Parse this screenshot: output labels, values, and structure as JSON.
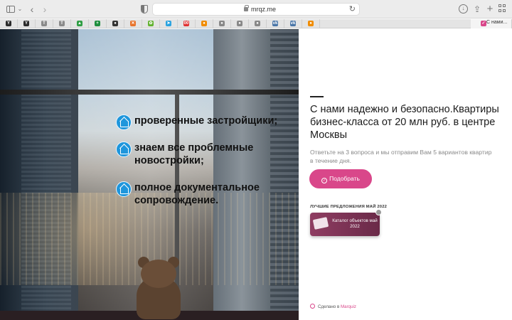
{
  "browser": {
    "url": "mrqz.me",
    "tab_title": "С нами...",
    "favorites": [
      {
        "icon": "bookmark-icon",
        "glyph": "Y",
        "color": "#2b2b2b"
      },
      {
        "icon": "bookmark-icon",
        "glyph": "Y",
        "color": "#2b2b2b"
      },
      {
        "icon": "bookmark-icon",
        "glyph": "T",
        "color": "#8a8a8a"
      },
      {
        "icon": "bookmark-icon",
        "glyph": "T",
        "color": "#8a8a8a"
      },
      {
        "icon": "drive-icon",
        "glyph": "▲",
        "color": "#2f9e44"
      },
      {
        "icon": "sheets-icon",
        "glyph": "+",
        "color": "#1e8e3e"
      },
      {
        "icon": "contact-icon",
        "glyph": "●",
        "color": "#333333"
      },
      {
        "icon": "tools-icon",
        "glyph": "✕",
        "color": "#e8742c"
      },
      {
        "icon": "leaf-icon",
        "glyph": "✿",
        "color": "#62b22f"
      },
      {
        "icon": "telegram-icon",
        "glyph": "➤",
        "color": "#2aa3e0"
      },
      {
        "icon": "tag-icon",
        "glyph": "00",
        "color": "#e03131"
      },
      {
        "icon": "cloud-icon",
        "glyph": "●",
        "color": "#f08c00"
      },
      {
        "icon": "cat-icon",
        "glyph": "●",
        "color": "#888888"
      },
      {
        "icon": "cat-icon",
        "glyph": "●",
        "color": "#888888"
      },
      {
        "icon": "cat-icon",
        "glyph": "●",
        "color": "#888888"
      },
      {
        "icon": "vk-icon",
        "glyph": "vk",
        "color": "#4a76a8"
      },
      {
        "icon": "vk-icon",
        "glyph": "vk",
        "color": "#4a76a8"
      },
      {
        "icon": "cloud-icon",
        "glyph": "●",
        "color": "#f08c00"
      }
    ]
  },
  "features": [
    {
      "text": "проверенные застройщики;"
    },
    {
      "text": "знаем все проблемные новостройки;"
    },
    {
      "text": "полное документальное сопровождение."
    }
  ],
  "panel": {
    "headline": "С нами надежно и безопасно.Квартиры бизнес-класса от 20 млн руб. в центре Москвы",
    "subtext": "Ответьте на 3 вопроса и мы отправим Вам 5 вариантов квартир в течение дня.",
    "cta_label": "Подобрать",
    "offers_label": "ЛУЧШИЕ ПРЕДЛОЖЕНИЯ МАЙ 2022",
    "catalog_title": "Каталог объектов май 2022",
    "made_with": "Сделано в",
    "made_with_brand": "Marquiz"
  },
  "colors": {
    "accent": "#d9478a",
    "feature_icon": "#1e96dc"
  }
}
